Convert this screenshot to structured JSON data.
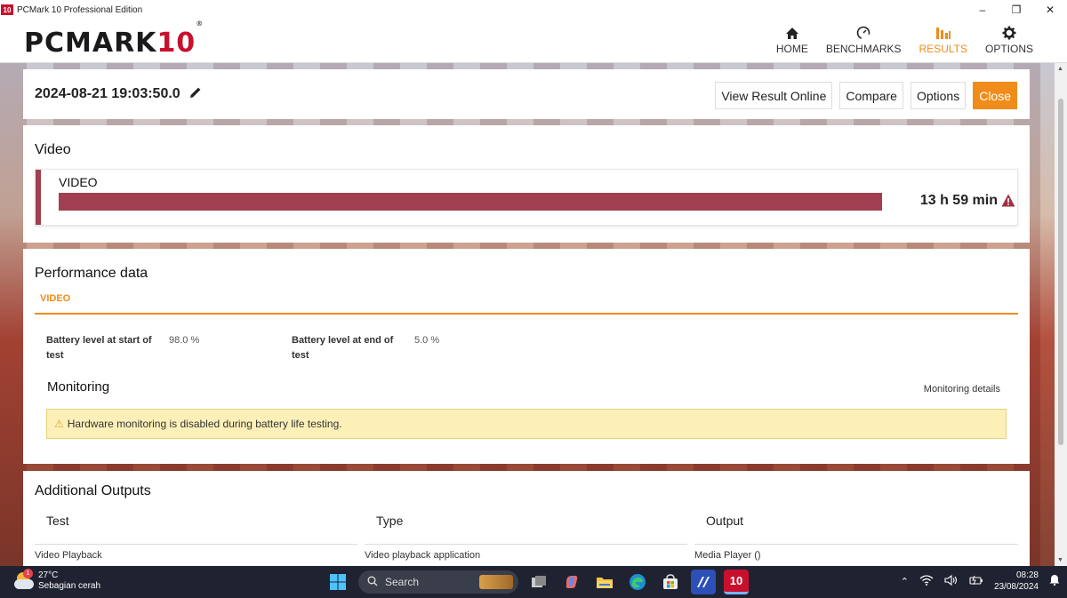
{
  "window": {
    "icon_text": "10",
    "title": "PCMark 10 Professional Edition",
    "controls": [
      "–",
      "❐",
      "✕"
    ]
  },
  "header": {
    "logo_main": "PCMARK",
    "logo_num": "10",
    "logo_reg": "®",
    "nav": [
      {
        "label": "HOME",
        "icon": "home-icon",
        "active": false
      },
      {
        "label": "BENCHMARKS",
        "icon": "gauge-icon",
        "active": false
      },
      {
        "label": "RESULTS",
        "icon": "bar-chart-icon",
        "active": true
      },
      {
        "label": "OPTIONS",
        "icon": "gear-icon",
        "active": false
      }
    ]
  },
  "result": {
    "date": "2024-08-21 19:03:50.0",
    "buttons": {
      "view_online": "View Result Online",
      "compare": "Compare",
      "options": "Options",
      "close": "Close"
    }
  },
  "video": {
    "title": "Video",
    "label": "VIDEO",
    "value": "13 h 59 min",
    "bar_color": "#a04050"
  },
  "performance": {
    "title": "Performance data",
    "tab": "VIDEO",
    "metrics": [
      {
        "label": "Battery level at start of test",
        "value": "98.0 %"
      },
      {
        "label": "Battery level at end of test",
        "value": "5.0 %"
      }
    ],
    "monitoring_title": "Monitoring",
    "monitoring_link": "Monitoring details",
    "notice": "Hardware monitoring is disabled during battery life testing."
  },
  "additional": {
    "title": "Additional Outputs",
    "columns": [
      "Test",
      "Type",
      "Output"
    ],
    "rows": [
      [
        "Video Playback",
        "Video playback application",
        "Media Player ()"
      ]
    ]
  },
  "taskbar": {
    "temperature": "27°C",
    "weather": "Sebagian cerah",
    "weather_badge": "1",
    "search_placeholder": "Search",
    "time": "08:28",
    "date": "23/08/2024",
    "pcmark_icon_text": "10"
  },
  "colors": {
    "accent": "#f08c1a",
    "brand_red": "#c8102e",
    "video_bar": "#a04050"
  }
}
